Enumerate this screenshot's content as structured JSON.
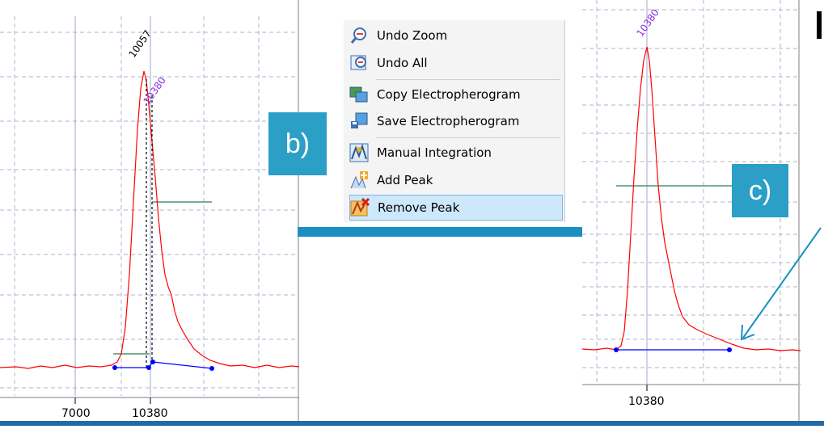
{
  "left_plot": {
    "peak_label_black": "10057",
    "peak_label_purple": "10380",
    "x_ticks": [
      "7000",
      "10380"
    ]
  },
  "right_plot": {
    "peak_label_purple": "10380",
    "x_tick": "10380"
  },
  "callouts": {
    "b": "b)",
    "c": "c)"
  },
  "context_menu": {
    "items": [
      {
        "label": "Undo Zoom",
        "icon": "zoom-undo-icon"
      },
      {
        "label": "Undo All",
        "icon": "undo-all-icon"
      },
      {
        "label": "Copy Electropherogram",
        "icon": "copy-image-icon"
      },
      {
        "label": "Save Electropherogram",
        "icon": "save-disk-icon"
      },
      {
        "label": "Manual Integration",
        "icon": "manual-integration-icon"
      },
      {
        "label": "Add Peak",
        "icon": "add-peak-icon"
      },
      {
        "label": "Remove Peak",
        "icon": "remove-peak-icon",
        "selected": true
      }
    ]
  },
  "colors": {
    "trace": "#ff0000",
    "baseline": "#0000ff",
    "accent": "#2b9fc6",
    "arrow": "#1a8fc0",
    "label_purple": "#8a2be2",
    "grid": "#a8b4d0"
  }
}
